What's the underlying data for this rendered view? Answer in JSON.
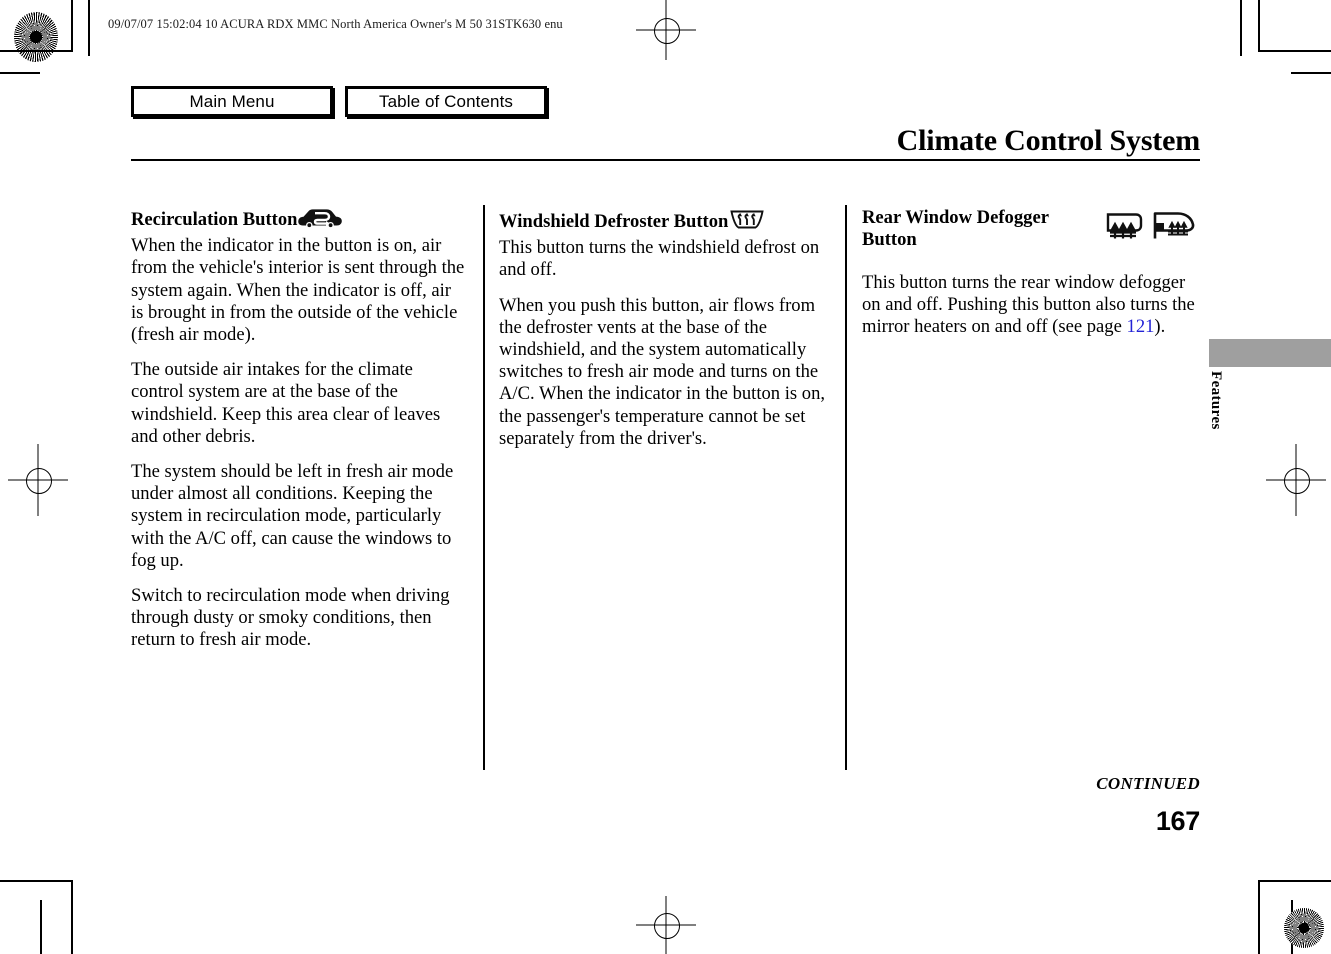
{
  "header": {
    "meta": "09/07/07 15:02:04    10 ACURA RDX MMC North America Owner's M 50 31STK630 enu",
    "main_menu_label": "Main Menu",
    "table_of_contents_label": "Table of Contents"
  },
  "chapter": {
    "title": "Climate Control System"
  },
  "columns": [
    {
      "heading": "Recirculation Button",
      "icon": "recirculation-car-icon",
      "paragraphs": [
        "When the indicator in the button is on, air from the vehicle's interior is sent through the system again. When the indicator is off, air is brought in from the outside of the vehicle (fresh air mode).",
        "The outside air intakes for the climate control system are at the base of the windshield. Keep this area clear of leaves and other debris.",
        "The system should be left in fresh air mode under almost all conditions. Keeping the system in recirculation mode, particularly with the A/C off, can cause the windows to fog up.",
        "Switch to recirculation mode when driving through dusty or smoky conditions, then return to fresh air mode."
      ]
    },
    {
      "heading": "Windshield Defroster Button",
      "icon": "windshield-defroster-icon",
      "paragraphs": [
        "This button turns the windshield defrost on and off.",
        "When you push this button, air flows from the defroster vents at the base of the windshield, and the system automatically switches to fresh air mode and turns on the A/C. When the indicator in the button is on, the passenger's temperature cannot be set separately from the driver's."
      ]
    },
    {
      "heading_line1": "Rear Window Defogger",
      "heading_line2": "Button",
      "icon_1": "rear-window-defogger-icon",
      "icon_2": "mirror-heater-icon",
      "paragraph_part1": "This button turns the rear window defogger on and off. Pushing this button also turns the mirror heaters on and off (see page ",
      "page_link": "121",
      "paragraph_part2": ")."
    }
  ],
  "side_tab": {
    "label": "Features"
  },
  "footer": {
    "continued": "CONTINUED",
    "page_number": "167"
  },
  "colors": {
    "link": "#2323d6",
    "tab": "#9f9f9f",
    "text": "#000000"
  }
}
